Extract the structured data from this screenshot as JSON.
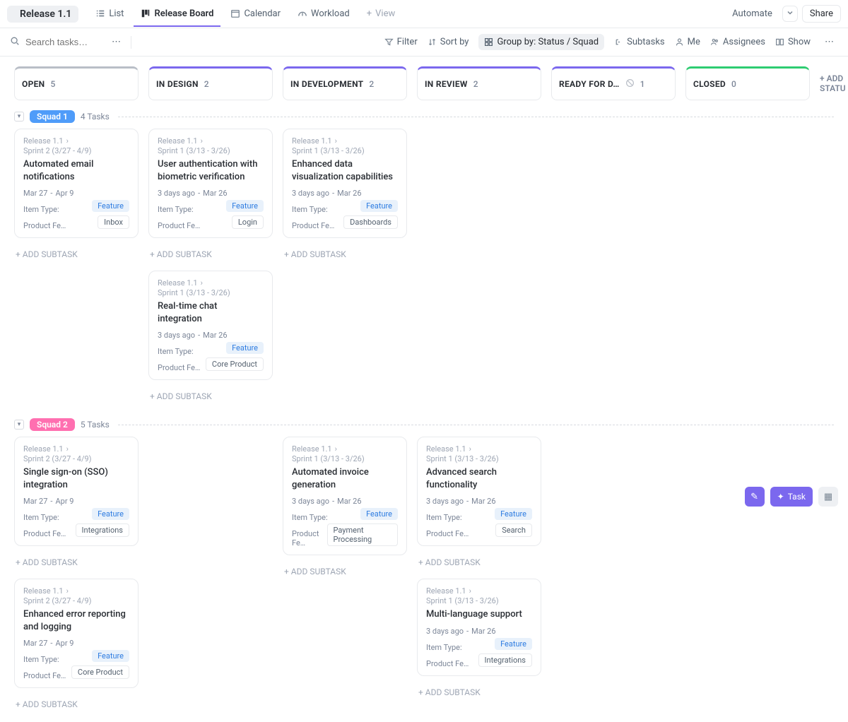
{
  "title": "Release 1.1",
  "tabs": {
    "list": "List",
    "board": "Release Board",
    "calendar": "Calendar",
    "workload": "Workload",
    "view": "View"
  },
  "topbar": {
    "automate": "Automate",
    "share": "Share"
  },
  "filterbar": {
    "search_ph": "Search tasks…",
    "filter": "Filter",
    "sort": "Sort by",
    "group": "Group by: Status / Squad",
    "subtasks": "Subtasks",
    "me": "Me",
    "assignees": "Assignees",
    "show": "Show"
  },
  "columns": {
    "open": {
      "label": "OPEN",
      "count": "5"
    },
    "design": {
      "label": "IN DESIGN",
      "count": "2"
    },
    "dev": {
      "label": "IN DEVELOPMENT",
      "count": "2"
    },
    "review": {
      "label": "IN REVIEW",
      "count": "2"
    },
    "ready": {
      "label": "READY FOR D…",
      "count": "1"
    },
    "closed": {
      "label": "CLOSED",
      "count": "0"
    },
    "add_status": "+ ADD STATU"
  },
  "lanes": {
    "sq1": {
      "badge": "Squad 1",
      "tasks": "4 Tasks"
    },
    "sq2": {
      "badge": "Squad 2",
      "tasks": "5 Tasks"
    }
  },
  "common": {
    "item_type": "Item Type:",
    "product_feat": "Product Fe…",
    "feature_pill": "Feature",
    "add_subtask": "ADD SUBTASK"
  },
  "cards": {
    "sq1_open": {
      "crumb1": "Release 1.1",
      "crumb2": "Sprint 2 (3/27 - 4/9)",
      "title": "Automated email notifications",
      "d1": "Mar 27",
      "d2": "Apr 9",
      "tag": "Inbox"
    },
    "sq1_design1": {
      "crumb1": "Release 1.1",
      "crumb2": "Sprint 1 (3/13 - 3/26)",
      "title": "User authentication with biomet­ric verification",
      "d1": "3 days ago",
      "d2": "Mar 26",
      "tag": "Login"
    },
    "sq1_design2": {
      "crumb1": "Release 1.1",
      "crumb2": "Sprint 1 (3/13 - 3/26)",
      "title": "Real-time chat integration",
      "d1": "3 days ago",
      "d2": "Mar 26",
      "tag": "Core Product"
    },
    "sq1_dev": {
      "crumb1": "Release 1.1",
      "crumb2": "Sprint 1 (3/13 - 3/26)",
      "title": "Enhanced data visualization ca­pabilities",
      "d1": "3 days ago",
      "d2": "Mar 26",
      "tag": "Dashboards"
    },
    "sq2_open1": {
      "crumb1": "Release 1.1",
      "crumb2": "Sprint 2 (3/27 - 4/9)",
      "title": "Single sign-on (SSO) integration",
      "d1": "Mar 27",
      "d2": "Apr 9",
      "tag": "Integrations"
    },
    "sq2_open2": {
      "crumb1": "Release 1.1",
      "crumb2": "Sprint 2 (3/27 - 4/9)",
      "title": "Enhanced error reporting and logging",
      "d1": "Mar 27",
      "d2": "Apr 9",
      "tag": "Core Product"
    },
    "sq2_dev": {
      "crumb1": "Release 1.1",
      "crumb2": "Sprint 1 (3/13 - 3/26)",
      "title": "Automated invoice generation",
      "d1": "3 days ago",
      "d2": "Mar 26",
      "tag": "Payment Processing"
    },
    "sq2_rev1": {
      "crumb1": "Release 1.1",
      "crumb2": "Sprint 1 (3/13 - 3/26)",
      "title": "Advanced search functionality",
      "d1": "3 days ago",
      "d2": "Mar 26",
      "tag": "Search"
    },
    "sq2_rev2": {
      "crumb1": "Release 1.1",
      "crumb2": "Sprint 1 (3/13 - 3/26)",
      "title": "Multi-language support",
      "d1": "3 days ago",
      "d2": "Mar 26",
      "tag": "Integrations"
    }
  }
}
